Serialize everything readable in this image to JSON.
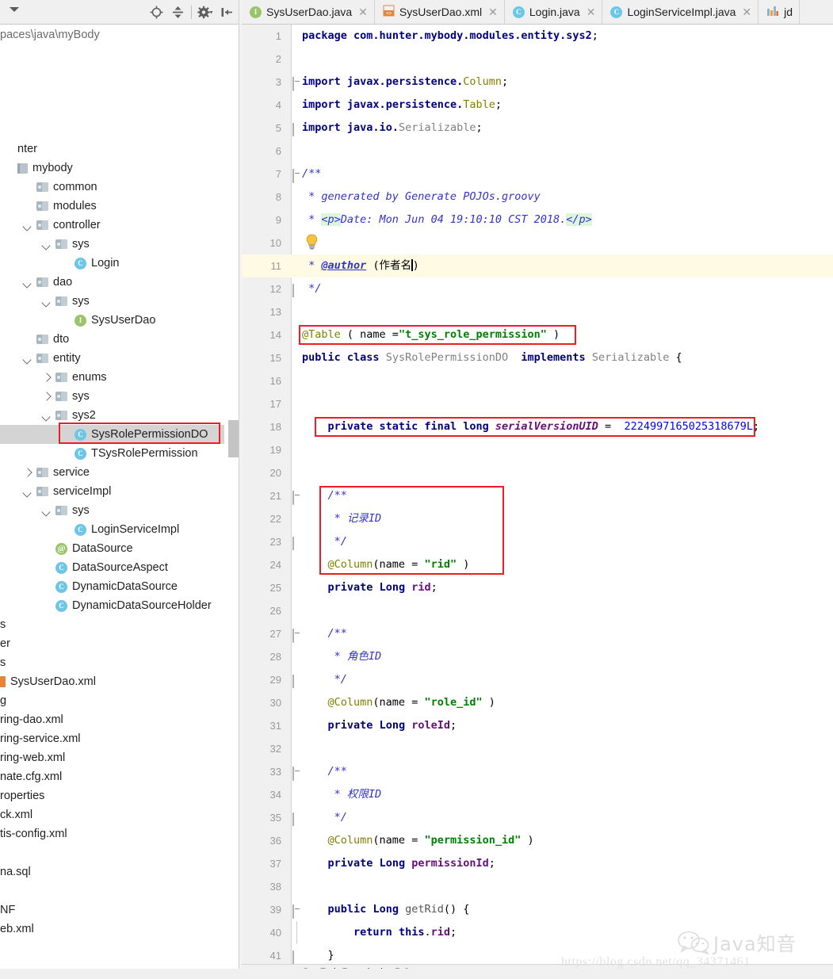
{
  "project_panel": {
    "path_label": "paces\\java\\myBody",
    "toolbar": {
      "collapse_caret": "collapse-caret",
      "icons": [
        "locate-target-icon",
        "collapse-all-icon",
        "settings-gear-icon",
        "hide-panel-icon"
      ]
    },
    "tree": [
      {
        "label": "nter",
        "indent": 0,
        "arrow": "none",
        "icon": "none"
      },
      {
        "label": "mybody",
        "indent": 0,
        "arrow": "none",
        "icon": "module"
      },
      {
        "label": "common",
        "indent": 1,
        "arrow": "none",
        "icon": "folder"
      },
      {
        "label": "modules",
        "indent": 1,
        "arrow": "none",
        "icon": "folder"
      },
      {
        "label": "controller",
        "indent": 1,
        "arrow": "down",
        "icon": "folder"
      },
      {
        "label": "sys",
        "indent": 2,
        "arrow": "down",
        "icon": "folder"
      },
      {
        "label": "Login",
        "indent": 3,
        "arrow": "none",
        "icon": "class"
      },
      {
        "label": "dao",
        "indent": 1,
        "arrow": "down",
        "icon": "folder"
      },
      {
        "label": "sys",
        "indent": 2,
        "arrow": "down",
        "icon": "folder"
      },
      {
        "label": "SysUserDao",
        "indent": 3,
        "arrow": "none",
        "icon": "interface"
      },
      {
        "label": "dto",
        "indent": 1,
        "arrow": "none",
        "icon": "folder"
      },
      {
        "label": "entity",
        "indent": 1,
        "arrow": "down",
        "icon": "folder"
      },
      {
        "label": "enums",
        "indent": 2,
        "arrow": "right",
        "icon": "folder"
      },
      {
        "label": "sys",
        "indent": 2,
        "arrow": "right",
        "icon": "folder"
      },
      {
        "label": "sys2",
        "indent": 2,
        "arrow": "down",
        "icon": "folder"
      },
      {
        "label": "SysRolePermissionDO",
        "indent": 3,
        "arrow": "none",
        "icon": "class",
        "selected": true,
        "highlighted": true
      },
      {
        "label": "TSysRolePermission",
        "indent": 3,
        "arrow": "none",
        "icon": "class"
      },
      {
        "label": "service",
        "indent": 1,
        "arrow": "right",
        "icon": "folder"
      },
      {
        "label": "serviceImpl",
        "indent": 1,
        "arrow": "down",
        "icon": "folder"
      },
      {
        "label": "sys",
        "indent": 2,
        "arrow": "down",
        "icon": "folder"
      },
      {
        "label": "LoginServiceImpl",
        "indent": 3,
        "arrow": "none",
        "icon": "class"
      },
      {
        "label": "DataSource",
        "indent": 2,
        "arrow": "none",
        "icon": "annotation"
      },
      {
        "label": "DataSourceAspect",
        "indent": 2,
        "arrow": "none",
        "icon": "class"
      },
      {
        "label": "DynamicDataSource",
        "indent": 2,
        "arrow": "none",
        "icon": "class"
      },
      {
        "label": "DynamicDataSourceHolder",
        "indent": 2,
        "arrow": "none",
        "icon": "class"
      },
      {
        "label": "s",
        "indent": -1,
        "arrow": "none",
        "icon": "none"
      },
      {
        "label": "er",
        "indent": -1,
        "arrow": "none",
        "icon": "none"
      },
      {
        "label": "s",
        "indent": -1,
        "arrow": "none",
        "icon": "none"
      },
      {
        "label": "SysUserDao.xml",
        "indent": -1,
        "arrow": "none",
        "icon": "xmlfile"
      },
      {
        "label": "g",
        "indent": -1,
        "arrow": "none",
        "icon": "none"
      },
      {
        "label": "ring-dao.xml",
        "indent": -1,
        "arrow": "none",
        "icon": "none"
      },
      {
        "label": "ring-service.xml",
        "indent": -1,
        "arrow": "none",
        "icon": "none"
      },
      {
        "label": "ring-web.xml",
        "indent": -1,
        "arrow": "none",
        "icon": "none"
      },
      {
        "label": "nate.cfg.xml",
        "indent": -1,
        "arrow": "none",
        "icon": "none"
      },
      {
        "label": "roperties",
        "indent": -1,
        "arrow": "none",
        "icon": "none"
      },
      {
        "label": "ck.xml",
        "indent": -1,
        "arrow": "none",
        "icon": "none"
      },
      {
        "label": "tis-config.xml",
        "indent": -1,
        "arrow": "none",
        "icon": "none"
      },
      {
        "label": "",
        "indent": -1,
        "arrow": "none",
        "icon": "none"
      },
      {
        "label": "na.sql",
        "indent": -1,
        "arrow": "none",
        "icon": "none"
      },
      {
        "label": "",
        "indent": -1,
        "arrow": "none",
        "icon": "none"
      },
      {
        "label": "NF",
        "indent": -1,
        "arrow": "none",
        "icon": "none"
      },
      {
        "label": "eb.xml",
        "indent": -1,
        "arrow": "none",
        "icon": "none"
      }
    ]
  },
  "editor": {
    "tabs": [
      {
        "label": "SysUserDao.java",
        "icon": "interface-icon",
        "active": false,
        "closable": true
      },
      {
        "label": "SysUserDao.xml",
        "icon": "xml-file-icon",
        "active": false,
        "closable": true
      },
      {
        "label": "Login.java",
        "icon": "class-icon",
        "active": false,
        "closable": true
      },
      {
        "label": "LoginServiceImpl.java",
        "icon": "class-icon",
        "active": false,
        "closable": true
      },
      {
        "label": "jd",
        "icon": "chart-file-icon",
        "active": false,
        "closable": false
      }
    ],
    "breadcrumb": "SysRolePermissionDO",
    "line_count": 41,
    "highlighted_line": 11,
    "intention_bulb_line": 10,
    "lines": [
      {
        "n": 1,
        "text": "package com.hunter.mybody.modules.entity.sys2;"
      },
      {
        "n": 2,
        "text": ""
      },
      {
        "n": 3,
        "text": "import javax.persistence.Column;"
      },
      {
        "n": 4,
        "text": "import javax.persistence.Table;"
      },
      {
        "n": 5,
        "text": "import java.io.Serializable;"
      },
      {
        "n": 6,
        "text": ""
      },
      {
        "n": 7,
        "text": "/**"
      },
      {
        "n": 8,
        "text": " * generated by Generate POJOs.groovy"
      },
      {
        "n": 9,
        "text": " * <p>Date: Mon Jun 04 19:10:10 CST 2018.</p>"
      },
      {
        "n": 10,
        "text": ""
      },
      {
        "n": 11,
        "text": " * @author (作者名)"
      },
      {
        "n": 12,
        "text": " */"
      },
      {
        "n": 13,
        "text": ""
      },
      {
        "n": 14,
        "text": "@Table ( name =\"t_sys_role_permission\" )"
      },
      {
        "n": 15,
        "text": "public class SysRolePermissionDO  implements Serializable {"
      },
      {
        "n": 16,
        "text": ""
      },
      {
        "n": 17,
        "text": ""
      },
      {
        "n": 18,
        "text": "    private static final long serialVersionUID =  2224997165025318679L;"
      },
      {
        "n": 19,
        "text": ""
      },
      {
        "n": 20,
        "text": ""
      },
      {
        "n": 21,
        "text": "    /**"
      },
      {
        "n": 22,
        "text": "     * 记录ID"
      },
      {
        "n": 23,
        "text": "     */"
      },
      {
        "n": 24,
        "text": "    @Column(name = \"rid\" )"
      },
      {
        "n": 25,
        "text": "    private Long rid;"
      },
      {
        "n": 26,
        "text": ""
      },
      {
        "n": 27,
        "text": "    /**"
      },
      {
        "n": 28,
        "text": "     * 角色ID"
      },
      {
        "n": 29,
        "text": "     */"
      },
      {
        "n": 30,
        "text": "    @Column(name = \"role_id\" )"
      },
      {
        "n": 31,
        "text": "    private Long roleId;"
      },
      {
        "n": 32,
        "text": ""
      },
      {
        "n": 33,
        "text": "    /**"
      },
      {
        "n": 34,
        "text": "     * 权限ID"
      },
      {
        "n": 35,
        "text": "     */"
      },
      {
        "n": 36,
        "text": "    @Column(name = \"permission_id\" )"
      },
      {
        "n": 37,
        "text": "    private Long permissionId;"
      },
      {
        "n": 38,
        "text": ""
      },
      {
        "n": 39,
        "text": "    public Long getRid() {"
      },
      {
        "n": 40,
        "text": "        return this.rid;"
      },
      {
        "n": 41,
        "text": "    }"
      }
    ],
    "annotations": [
      {
        "name": "table-annotation-box",
        "target_lines": "14"
      },
      {
        "name": "serialversionuid-box",
        "target_lines": "18"
      },
      {
        "name": "rid-column-box",
        "target_lines": "21-24"
      }
    ]
  },
  "watermark": {
    "brand": "Java知音",
    "url": "https://blog.csdn.net/qq_34371461",
    "logo": "wechat-icon"
  },
  "colors": {
    "keyword": "#000080",
    "string": "#008000",
    "javadoc": "#3333cc",
    "annotation": "#808000",
    "field": "#660e7a",
    "number": "#0000ff",
    "highlight_line": "#fffae3",
    "selection": "#d4d4d4",
    "redbox": "#ee1c25",
    "panel_bg": "#f0f0f0"
  }
}
